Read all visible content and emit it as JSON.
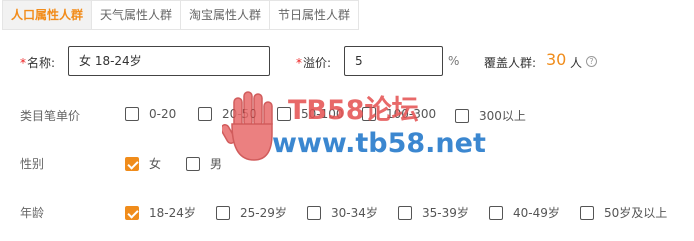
{
  "tabs": [
    {
      "label": "人口属性人群",
      "active": true
    },
    {
      "label": "天气属性人群",
      "active": false
    },
    {
      "label": "淘宝属性人群",
      "active": false
    },
    {
      "label": "节日属性人群",
      "active": false
    }
  ],
  "form": {
    "required_mark": "*",
    "name_label": "名称:",
    "name_value": "女 18-24岁",
    "premium_label": "溢价:",
    "premium_value": "5",
    "premium_unit": "%",
    "coverage_label": "覆盖人群:",
    "coverage_count": "30",
    "coverage_unit": "人",
    "help_glyph": "?"
  },
  "price": {
    "label": "类目笔单价",
    "options": [
      {
        "label": "0-20",
        "checked": false
      },
      {
        "label": "20-50",
        "checked": false
      },
      {
        "label": "50-100",
        "checked": false
      },
      {
        "label": "100-300",
        "checked": false
      },
      {
        "label": "300以上",
        "checked": false
      }
    ]
  },
  "gender": {
    "label": "性别",
    "options": [
      {
        "label": "女",
        "checked": true
      },
      {
        "label": "男",
        "checked": false
      }
    ]
  },
  "age": {
    "label": "年龄",
    "options": [
      {
        "label": "18-24岁",
        "checked": true
      },
      {
        "label": "25-29岁",
        "checked": false
      },
      {
        "label": "30-34岁",
        "checked": false
      },
      {
        "label": "35-39岁",
        "checked": false
      },
      {
        "label": "40-49岁",
        "checked": false
      },
      {
        "label": "50岁及以上",
        "checked": false
      }
    ]
  },
  "watermark": {
    "title": "TB58论坛",
    "url": "www.tb58.net",
    "icon": "hand-icon"
  },
  "colors": {
    "accent": "#f08c1b",
    "required": "#e22222",
    "watermark_red": "#e45050",
    "watermark_blue": "#1a73c8"
  }
}
